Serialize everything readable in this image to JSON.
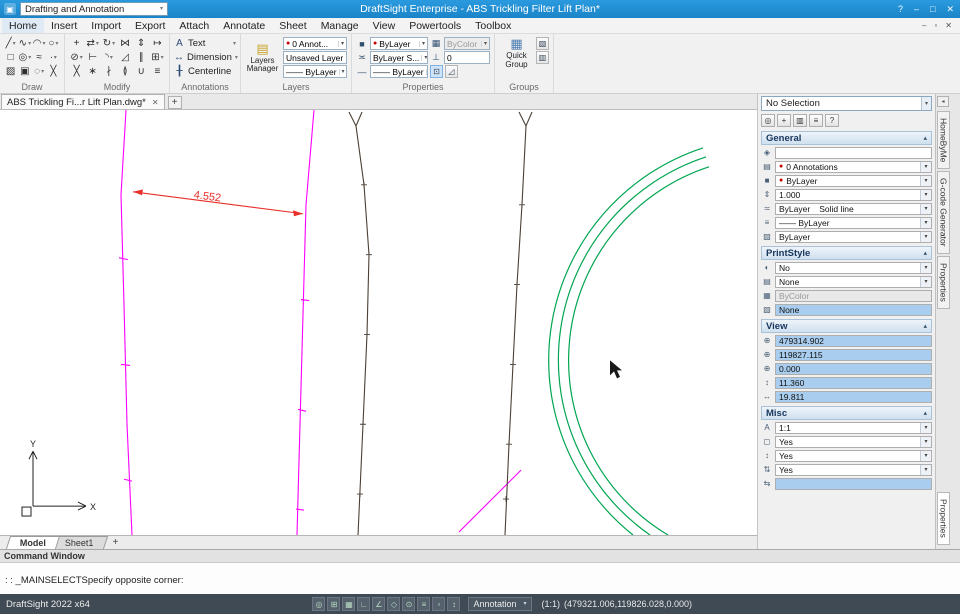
{
  "window": {
    "app_icon": "▣",
    "workspace_selector": "Drafting and Annotation",
    "title": "DraftSight Enterprise - ABS Trickling Filter Lift Plan*",
    "controls": [
      {
        "name": "help-button",
        "glyph": "?"
      },
      {
        "name": "minimize-button",
        "glyph": "–"
      },
      {
        "name": "maximize-button",
        "glyph": "□"
      },
      {
        "name": "close-button",
        "glyph": "✕"
      }
    ]
  },
  "menu": {
    "items": [
      {
        "label": "Home",
        "cls": "active"
      },
      {
        "label": "Insert"
      },
      {
        "label": "Import"
      },
      {
        "label": "Export"
      },
      {
        "label": "Attach"
      },
      {
        "label": "Annotate"
      },
      {
        "label": "Sheet"
      },
      {
        "label": "Manage"
      },
      {
        "label": "View"
      },
      {
        "label": "Powertools"
      },
      {
        "label": "Toolbox"
      }
    ],
    "window_controls": [
      {
        "name": "doc-minimize-button",
        "glyph": "–"
      },
      {
        "name": "doc-restore-button",
        "glyph": "▫"
      },
      {
        "name": "doc-close-button",
        "glyph": "✕"
      }
    ]
  },
  "ribbon": {
    "draw": {
      "label": "Draw",
      "tools": [
        {
          "n": "line-tool",
          "g": "╱",
          "dd": true
        },
        {
          "n": "polyline-tool",
          "g": "∿",
          "dd": true
        },
        {
          "n": "arc-tool",
          "g": "◠",
          "dd": true
        },
        {
          "n": "circle-tool",
          "g": "○",
          "dd": true
        },
        {
          "n": "rectangle-tool",
          "g": "□"
        },
        {
          "n": "ellipse-tool",
          "g": "◎",
          "dd": true
        },
        {
          "n": "spline-tool",
          "g": "≈"
        },
        {
          "n": "point-tool",
          "g": "∙",
          "dd": true
        },
        {
          "n": "hatch-tool",
          "g": "▨"
        },
        {
          "n": "region-tool",
          "g": "▣"
        },
        {
          "n": "cloud-tool",
          "g": "◌",
          "dd": true
        },
        {
          "n": "sketch-tool",
          "g": "╳"
        }
      ]
    },
    "modify": {
      "label": "Modify",
      "tools": [
        {
          "n": "move-tool",
          "g": "+"
        },
        {
          "n": "copy-tool",
          "g": "⇄",
          "dd": true
        },
        {
          "n": "rotate-tool",
          "g": "↻",
          "dd": true
        },
        {
          "n": "mirror-tool",
          "g": "⋈"
        },
        {
          "n": "scale-tool",
          "g": "⇕"
        },
        {
          "n": "stretch-tool",
          "g": "↦"
        },
        {
          "n": "trim-tool",
          "g": "⊘",
          "dd": true
        },
        {
          "n": "extend-tool",
          "g": "⊢"
        },
        {
          "n": "fillet-tool",
          "g": "◝",
          "dd": true
        },
        {
          "n": "chamfer-tool",
          "g": "◿"
        },
        {
          "n": "offset-tool",
          "g": "∥"
        },
        {
          "n": "pattern-tool",
          "g": "⊞",
          "dd": true
        },
        {
          "n": "delete-tool",
          "g": "╳"
        },
        {
          "n": "explode-tool",
          "g": "∗"
        },
        {
          "n": "split-tool",
          "g": "∤"
        },
        {
          "n": "edit-annotation-tool",
          "g": "≬"
        },
        {
          "n": "join-tool",
          "g": "∪"
        },
        {
          "n": "entity-grips-tool",
          "g": "≡"
        }
      ]
    },
    "annotations": {
      "label": "Annotations",
      "items": [
        {
          "n": "text-tool",
          "g": "A",
          "label": "Text",
          "dd": true
        },
        {
          "n": "dimension-tool",
          "g": "↔",
          "label": "Dimension",
          "dd": true
        },
        {
          "n": "centerline-tool",
          "g": "╂",
          "label": "Centerline"
        }
      ]
    },
    "layers": {
      "label": "Layers",
      "manager_label": "Layers Manager",
      "layer_value": "0 Annot...",
      "state_value": "Unsaved Layer St...",
      "lineweight_value": "—— ByLayer"
    },
    "properties": {
      "label": "Properties",
      "color_value": "ByLayer",
      "bycolor_value": "ByColor",
      "linestyle_value": "ByLayer  S...",
      "thickness_value": "0",
      "lineweight_value": "—— ByLayer"
    },
    "groups": {
      "label": "Groups",
      "quick_group_label": "Quick Group"
    }
  },
  "doc_tab": {
    "label": "ABS Trickling Fi...r Lift Plan.dwg*"
  },
  "drawing": {
    "dimension_label": "4.552",
    "axis_x_label": "X",
    "axis_y_label": "Y"
  },
  "properties_panel": {
    "selection_value": "No Selection",
    "toolbar": [
      {
        "name": "select-entities-button",
        "g": "◎"
      },
      {
        "name": "quick-select-button",
        "g": "+"
      },
      {
        "name": "pin-palette-button",
        "g": "▥"
      },
      {
        "name": "palette-options-button",
        "g": "≡"
      },
      {
        "name": "palette-help-button",
        "g": "?"
      }
    ],
    "sections": {
      "general": {
        "label": "General",
        "rows": [
          {
            "icon": "◈",
            "value": "",
            "name": "link-field"
          },
          {
            "icon": "▤",
            "dot": true,
            "value": "0 Annotations",
            "dd": true,
            "name": "layer-field"
          },
          {
            "icon": "■",
            "dot": true,
            "value": "ByLayer",
            "dd": true,
            "name": "linecolor-field"
          },
          {
            "icon": "⇕",
            "value": "1.000",
            "dd": true,
            "name": "linescale-field"
          },
          {
            "icon": "≍",
            "value": "ByLayer",
            "value2": "Solid line",
            "dd": true,
            "name": "linestyle-field"
          },
          {
            "icon": "≡",
            "value": "—— ByLayer",
            "dd": true,
            "name": "lineweight-field"
          },
          {
            "icon": "▨",
            "value": "ByLayer",
            "dd": true,
            "name": "transparency-field"
          }
        ]
      },
      "printstyle": {
        "label": "PrintStyle",
        "rows": [
          {
            "icon": "◐",
            "value": "No",
            "dd": true,
            "name": "print-field"
          },
          {
            "icon": "▤",
            "value": "None",
            "dd": true,
            "name": "printstyle-field"
          },
          {
            "icon": "▦",
            "value": "ByColor",
            "cls": "dis",
            "name": "printcolor-field"
          },
          {
            "icon": "▧",
            "value": "None",
            "cls": "hl",
            "name": "printtable-field"
          }
        ]
      },
      "view": {
        "label": "View",
        "rows": [
          {
            "icon": "⊕",
            "value": "479314.902",
            "cls": "hl",
            "name": "view-center-x-field"
          },
          {
            "icon": "⊕",
            "value": "119827.115",
            "cls": "hl",
            "name": "view-center-y-field"
          },
          {
            "icon": "⊕",
            "value": "0.000",
            "cls": "hl",
            "name": "view-center-z-field"
          },
          {
            "icon": "↕",
            "value": "11.360",
            "cls": "hl",
            "name": "view-height-field"
          },
          {
            "icon": "↔",
            "value": "19.811",
            "cls": "hl",
            "name": "view-width-field"
          }
        ]
      },
      "misc": {
        "label": "Misc",
        "rows": [
          {
            "icon": "A",
            "value": "1:1",
            "dd": true,
            "name": "annotation-scale-field"
          },
          {
            "icon": "◻",
            "value": "Yes",
            "dd": true,
            "name": "ucs-icon-visible-field"
          },
          {
            "icon": "↕",
            "value": "Yes",
            "dd": true,
            "name": "ucs-icon-origin-field"
          },
          {
            "icon": "⇅",
            "value": "Yes",
            "dd": true,
            "name": "ucs-per-viewport-field"
          },
          {
            "icon": "⇆",
            "value": "",
            "cls": "hl",
            "name": "misc-extra-field"
          }
        ]
      }
    }
  },
  "right_tabs": {
    "top": [
      {
        "label": "HomeByMe"
      },
      {
        "label": "G-code Generator"
      },
      {
        "label": "Properties"
      }
    ],
    "bottom": [
      {
        "label": "Properties",
        "cls": "active"
      }
    ]
  },
  "sheet_tabs": {
    "tabs": [
      {
        "label": "Model",
        "cls": "active"
      },
      {
        "label": "Sheet1"
      }
    ]
  },
  "command_window": {
    "title": "Command Window",
    "prompt": ": : _MAINSELECTSpecify opposite corner:"
  },
  "status_bar": {
    "app_version": "DraftSight 2022 x64",
    "toggles": [
      {
        "name": "selection-filter-icon",
        "g": "◎"
      },
      {
        "name": "grid-icon",
        "g": "⊞"
      },
      {
        "name": "snap-icon",
        "g": "▦"
      },
      {
        "name": "ortho-icon",
        "g": "∟"
      },
      {
        "name": "polar-icon",
        "g": "∠"
      },
      {
        "name": "esnap-icon",
        "g": "◇"
      },
      {
        "name": "etrack-icon",
        "g": "⊙"
      },
      {
        "name": "lineweight-icon",
        "g": "≡"
      },
      {
        "name": "quickinput-icon",
        "g": "▫"
      },
      {
        "name": "annotation-scale-icon",
        "g": "↕"
      }
    ],
    "annotation_dropdown": "Annotation",
    "scale": "(1:1)",
    "coords": "(479321.006,119826.028,0.000)"
  },
  "icons": {
    "chevron": "▾",
    "collapse": "▴",
    "close": "✕",
    "add": "+",
    "layers_manager": "▤",
    "quick_group": "▦",
    "group_tool_1": "▧",
    "group_tool_2": "▥",
    "color_swatch": "■",
    "bycolor": "▦",
    "linestyle": "≍",
    "thickness": "⊥",
    "active_tool": "⊡",
    "corner_tool": "◿",
    "strip_toggle": "◂"
  },
  "colors": {
    "titlebar_blue": "#1e8fd5",
    "boundary_magenta": "#ff00ff",
    "dimension_red": "#e8302a",
    "entity_green": "#00a651",
    "survey_dark": "#4a4036",
    "highlight_blue": "#a9cdee",
    "statusbar_slate": "#3f4a55"
  }
}
